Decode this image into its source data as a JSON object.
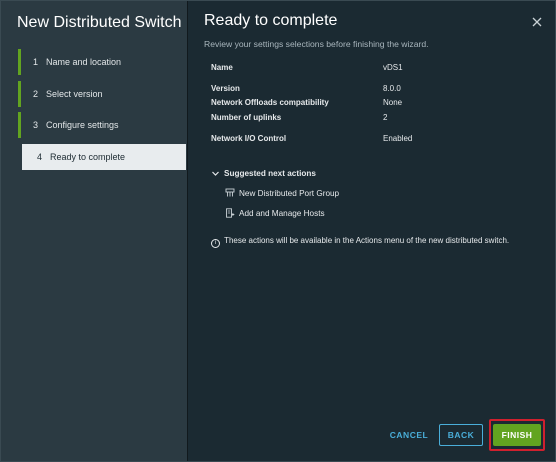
{
  "wizard": {
    "title": "New Distributed Switch",
    "steps": [
      {
        "num": "1",
        "label": "Name and location",
        "state": "completed"
      },
      {
        "num": "2",
        "label": "Select version",
        "state": "completed"
      },
      {
        "num": "3",
        "label": "Configure settings",
        "state": "completed"
      },
      {
        "num": "4",
        "label": "Ready to complete",
        "state": "active"
      }
    ]
  },
  "page": {
    "title": "Ready to complete",
    "subtitle": "Review your settings selections before finishing the wizard.",
    "summary": [
      {
        "label": "Name",
        "value": "vDS1"
      },
      {
        "label": "Version",
        "value": "8.0.0"
      },
      {
        "label": "Network Offloads compatibility",
        "value": "None"
      },
      {
        "label": "Number of uplinks",
        "value": "2"
      },
      {
        "label": "Network I/O Control",
        "value": "Enabled"
      }
    ],
    "suggested_title": "Suggested next actions",
    "actions": [
      {
        "label": "New Distributed Port Group",
        "icon": "port-group-icon"
      },
      {
        "label": "Add and Manage Hosts",
        "icon": "manage-hosts-icon"
      }
    ],
    "note": "These actions will be available in the Actions menu of the new distributed switch."
  },
  "buttons": {
    "cancel": "CANCEL",
    "back": "BACK",
    "finish": "FINISH"
  },
  "colors": {
    "accent_green": "#62a420",
    "link_blue": "#4aaed9",
    "highlight_red": "#d0202e"
  }
}
